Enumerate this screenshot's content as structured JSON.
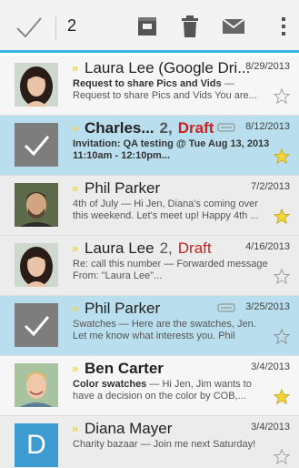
{
  "action_bar": {
    "selected_count": "2",
    "icons": [
      "done-check-icon",
      "archive-icon",
      "delete-icon",
      "mark-unread-icon",
      "overflow-menu-icon"
    ],
    "accent_color": "#33b5e5"
  },
  "colors": {
    "selected_row": "#b9dfee",
    "draft": "#cc1f1f",
    "starred": "#f5d33b"
  },
  "emails": [
    {
      "sender": "Laura Lee (Google Dri...",
      "count": "",
      "draft": "",
      "date": "8/29/2013",
      "subject": "Request to share Pics and Vids",
      "line2": "Request to share Pics and Vids You are...",
      "starred": false,
      "selected": false,
      "avatar": "photo-woman"
    },
    {
      "sender": "Charles...",
      "count": "2,",
      "draft": "Draft",
      "date": "8/12/2013",
      "subject": "Invitation: QA testing @ Tue Aug 13, 2013",
      "line2": "11:10am - 12:10pm...",
      "starred": true,
      "selected": true,
      "avatar": "selected-check"
    },
    {
      "sender": "Phil Parker",
      "count": "",
      "draft": "",
      "date": "7/2/2013",
      "subject": "4th of July",
      "line2": "Hi Jen, Diana's coming over this weekend. Let's meet up! Happy 4th ...",
      "starred": true,
      "selected": false,
      "avatar": "photo-man"
    },
    {
      "sender": "Laura Lee",
      "count": "2,",
      "draft": "Draft",
      "date": "4/16/2013",
      "subject": "Re: call this number",
      "line2": "Forwarded message From: \"Laura Lee\"...",
      "starred": false,
      "selected": false,
      "avatar": "photo-woman"
    },
    {
      "sender": "Phil Parker",
      "count": "",
      "draft": "",
      "date": "3/25/2013",
      "subject": "Swatches",
      "line2": "Here are the swatches, Jen. Let me know what interests you. Phil",
      "starred": false,
      "selected": true,
      "avatar": "selected-check"
    },
    {
      "sender": "Ben Carter",
      "count": "",
      "draft": "",
      "date": "3/4/2013",
      "subject": "Color swatches",
      "line2": "Hi Jen, Jim wants to have a decision on the color by COB,...",
      "starred": true,
      "selected": false,
      "avatar": "photo-man-blond"
    },
    {
      "sender": "Diana Mayer",
      "count": "",
      "draft": "",
      "date": "3/4/2013",
      "subject": "Charity bazaar",
      "line2": "Join me next Saturday!",
      "starred": false,
      "selected": false,
      "avatar": "letter-tile",
      "avatar_letter": "D"
    }
  ]
}
